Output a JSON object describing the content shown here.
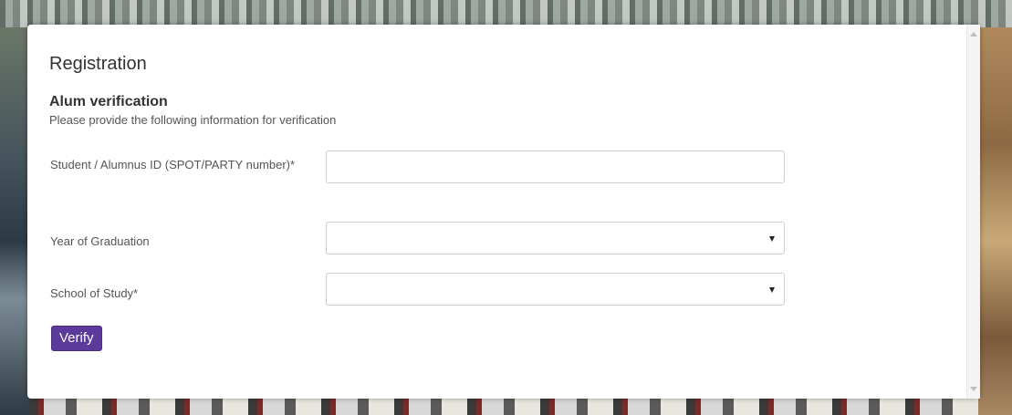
{
  "dialog": {
    "title": "Registration",
    "section_title": "Alum verification",
    "section_description": "Please provide the following information for verification"
  },
  "form": {
    "student_id": {
      "label": "Student / Alumnus ID (SPOT/PARTY number)*",
      "value": ""
    },
    "graduation_year": {
      "label": "Year of Graduation",
      "value": ""
    },
    "school_of_study": {
      "label": "School of Study*",
      "value": ""
    },
    "verify_label": "Verify"
  },
  "colors": {
    "accent": "#5b3a9b",
    "text": "#333333",
    "muted": "#555555",
    "border": "#cfcfcf"
  }
}
